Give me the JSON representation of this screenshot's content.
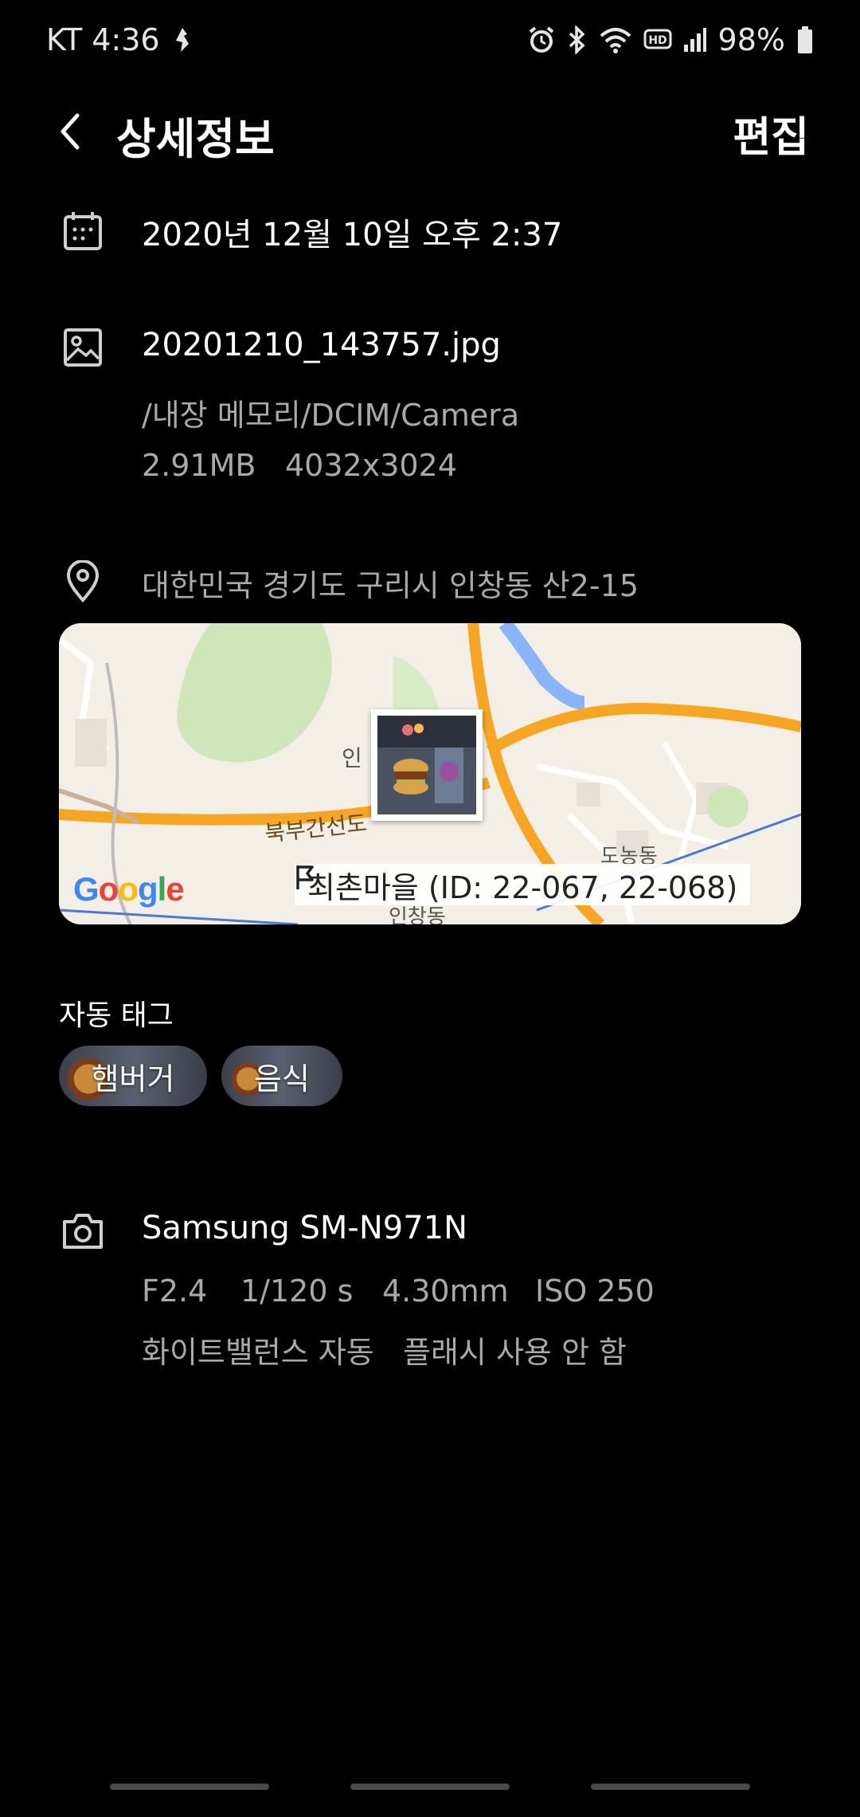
{
  "status_bar": {
    "carrier_time": "KT 4:36",
    "battery": "98%",
    "icons": [
      "notification-icon",
      "alarm-icon",
      "bluetooth-icon",
      "wifi-icon",
      "hd-voice-icon",
      "signal-icon",
      "battery-icon"
    ]
  },
  "header": {
    "title": "상세정보",
    "edit_label": "편집"
  },
  "date_row": {
    "icon": "calendar-icon",
    "text": "2020년 12월 10일 오후 2:37"
  },
  "file_row": {
    "icon": "image-icon",
    "filename": "20201210_143757.jpg",
    "path": "/내장 메모리/DCIM/Camera",
    "size": "2.91MB",
    "resolution": "4032x3024"
  },
  "location_row": {
    "icon": "location-pin-icon",
    "address": "대한민국 경기도 구리시 인창동 산2-15"
  },
  "map": {
    "place_label": "최촌마을 (ID: 22-067, 22-068)",
    "road_label": "북부간선도",
    "district_labels": [
      "인",
      "도농동",
      "인창동"
    ],
    "google_logo": "Google",
    "colors": {
      "water": "#8ab4f8",
      "park": "#cfe6b8",
      "road": "#f6a623",
      "land": "#f3eee6"
    }
  },
  "auto_tags": {
    "title": "자동 태그",
    "tags": [
      "햄버거",
      "음식"
    ]
  },
  "camera_row": {
    "icon": "camera-icon",
    "model": "Samsung SM-N971N",
    "aperture": "F2.4",
    "shutter": "1/120 s",
    "focal_length": "4.30mm",
    "iso": "ISO 250",
    "white_balance": "화이트밸런스 자동",
    "flash": "플래시 사용 안 함"
  }
}
